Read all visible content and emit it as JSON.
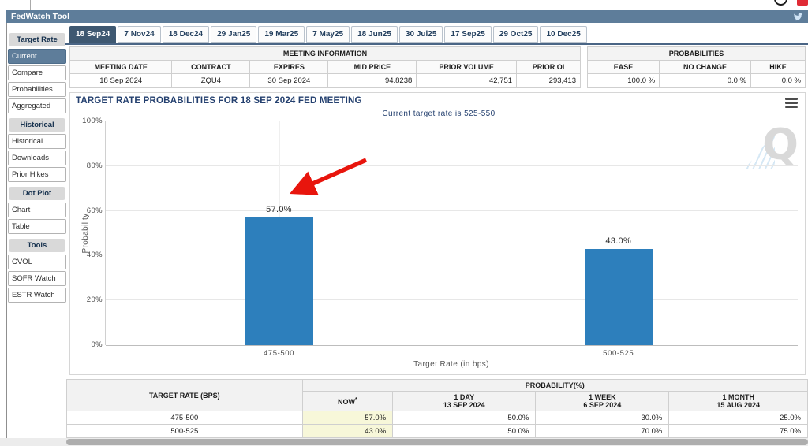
{
  "app": {
    "title": "FedWatch Tool"
  },
  "icons": {
    "twitter": "twitter-bird-icon",
    "chart_menu": "hamburger-icon",
    "watermark_text": "Q"
  },
  "colors": {
    "appbar": "#5e7d9a",
    "tab_selected": "#3e5871",
    "sidebar_selected": "#5e7d9a",
    "accent_navy": "#24406f",
    "bar": "#2d7fbc",
    "arrow": "#e8150d",
    "now_highlight": "#f7f7d9"
  },
  "tabs": {
    "selected_index": 0,
    "items": [
      "18 Sep24",
      "7 Nov24",
      "18 Dec24",
      "29 Jan25",
      "19 Mar25",
      "7 May25",
      "18 Jun25",
      "30 Jul25",
      "17 Sep25",
      "29 Oct25",
      "10 Dec25"
    ]
  },
  "sidebar": {
    "sections": [
      {
        "header": "Target Rate",
        "items": [
          {
            "label": "Current",
            "selected": true
          },
          {
            "label": "Compare",
            "selected": false
          },
          {
            "label": "Probabilities",
            "selected": false
          },
          {
            "label": "Aggregated",
            "selected": false
          }
        ]
      },
      {
        "header": "Historical",
        "items": [
          {
            "label": "Historical",
            "selected": false
          },
          {
            "label": "Downloads",
            "selected": false
          },
          {
            "label": "Prior Hikes",
            "selected": false
          }
        ]
      },
      {
        "header": "Dot Plot",
        "items": [
          {
            "label": "Chart",
            "selected": false
          },
          {
            "label": "Table",
            "selected": false
          }
        ]
      },
      {
        "header": "Tools",
        "items": [
          {
            "label": "CVOL",
            "selected": false
          },
          {
            "label": "SOFR Watch",
            "selected": false
          },
          {
            "label": "ESTR Watch",
            "selected": false
          }
        ]
      }
    ]
  },
  "meeting_info": {
    "title": "MEETING INFORMATION",
    "columns": [
      "MEETING DATE",
      "CONTRACT",
      "EXPIRES",
      "MID PRICE",
      "PRIOR VOLUME",
      "PRIOR OI"
    ],
    "values": [
      "18 Sep 2024",
      "ZQU4",
      "30 Sep 2024",
      "94.8238",
      "42,751",
      "293,413"
    ]
  },
  "probabilities_box": {
    "title": "PROBABILITIES",
    "columns": [
      "EASE",
      "NO CHANGE",
      "HIKE"
    ],
    "values": [
      "100.0 %",
      "0.0 %",
      "0.0 %"
    ]
  },
  "chart_data": {
    "type": "bar",
    "title": "TARGET RATE PROBABILITIES FOR 18 SEP 2024 FED MEETING",
    "subtitle": "Current target rate is 525-550",
    "categories": [
      "475-500",
      "500-525"
    ],
    "values": [
      57.0,
      43.0
    ],
    "value_labels": [
      "57.0%",
      "43.0%"
    ],
    "xlabel": "Target Rate (in bps)",
    "ylabel": "Probability",
    "ylim": [
      0,
      100
    ],
    "yticks": [
      "0%",
      "20%",
      "40%",
      "60%",
      "80%",
      "100%"
    ],
    "grid": true,
    "legend": "none",
    "annotation": "red arrow pointing at the 57.0% bar"
  },
  "bottom_table": {
    "col1_header": "TARGET RATE (BPS)",
    "group_header": "PROBABILITY(%)",
    "sub_headers": [
      {
        "label": "NOW",
        "sup": "*",
        "date": ""
      },
      {
        "label": "1 DAY",
        "sup": "",
        "date": "13 SEP 2024"
      },
      {
        "label": "1 WEEK",
        "sup": "",
        "date": "6 SEP 2024"
      },
      {
        "label": "1 MONTH",
        "sup": "",
        "date": "15 AUG 2024"
      }
    ],
    "rows": [
      {
        "target_rate": "475-500",
        "cells": [
          "57.0%",
          "50.0%",
          "30.0%",
          "25.0%"
        ]
      },
      {
        "target_rate": "500-525",
        "cells": [
          "43.0%",
          "50.0%",
          "70.0%",
          "75.0%"
        ]
      }
    ]
  }
}
